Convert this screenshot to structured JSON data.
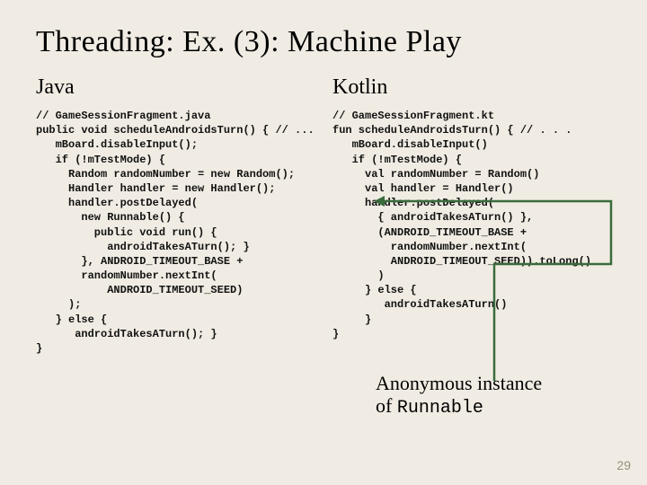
{
  "title": "Threading: Ex. (3): Machine Play",
  "java": {
    "heading": "Java",
    "code": "// GameSessionFragment.java\npublic void scheduleAndroidsTurn() { // ...\n   mBoard.disableInput();\n   if (!mTestMode) {\n     Random randomNumber = new Random();\n     Handler handler = new Handler();\n     handler.postDelayed(\n       new Runnable() {\n         public void run() {\n           androidTakesATurn(); }\n       }, ANDROID_TIMEOUT_BASE +\n       randomNumber.nextInt(\n           ANDROID_TIMEOUT_SEED)\n     );\n   } else {\n      androidTakesATurn(); }\n}"
  },
  "kotlin": {
    "heading": "Kotlin",
    "code": "// GameSessionFragment.kt\nfun scheduleAndroidsTurn() { // . . .\n   mBoard.disableInput()\n   if (!mTestMode) {\n     val randomNumber = Random()\n     val handler = Handler()\n     handler.postDelayed(\n       { androidTakesATurn() },\n       (ANDROID_TIMEOUT_BASE +\n         randomNumber.nextInt(\n         ANDROID_TIMEOUT_SEED)).toLong()\n       )\n     } else {\n        androidTakesATurn()\n     }\n}"
  },
  "annotation": {
    "line1": "Anonymous instance",
    "line2_prefix": "of ",
    "runnable": "Runnable"
  },
  "page_number": "29"
}
